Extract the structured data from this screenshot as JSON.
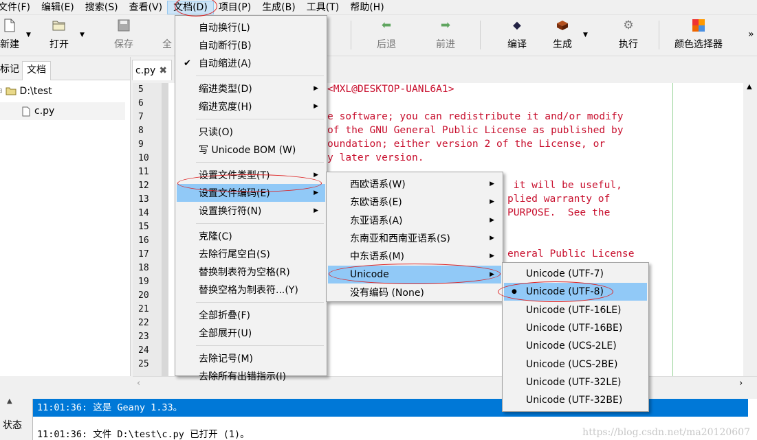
{
  "menubar": [
    "文件(F)",
    "编辑(E)",
    "搜索(S)",
    "查看(V)",
    "文档(D)",
    "项目(P)",
    "生成(B)",
    "工具(T)",
    "帮助(H)"
  ],
  "toolbar": {
    "new": "新建",
    "open": "打开",
    "save": "保存",
    "save_all_partial": "全",
    "back": "后退",
    "forward": "前进",
    "compile": "编译",
    "build": "生成",
    "execute": "执行",
    "color_picker": "颜色选择器",
    "overflow": "»"
  },
  "sidebar": {
    "tabs": [
      "标记",
      "文档"
    ],
    "tree": {
      "folder": "D:\\test",
      "file": "c.py"
    }
  },
  "editor": {
    "tab": "c.py",
    "line_numbers": [
      "5",
      "6",
      "7",
      "8",
      "9",
      "10",
      "11",
      "12",
      "13",
      "14",
      "15",
      "16",
      "17",
      "18",
      "19",
      "20",
      "21",
      "22",
      "23",
      "24",
      "25"
    ],
    "visible_text": [
      "<MXL@DESKTOP-UANL6A1>",
      "",
      "e software; you can redistribute it and/or modify",
      "of the GNU General Public License as published by",
      "oundation; either version 2 of the License, or",
      "y later version.",
      "",
      " it will be useful,",
      "plied warranty of",
      "PURPOSE.  See the",
      "",
      "",
      "eneral Public License"
    ]
  },
  "document_menu": {
    "items": [
      {
        "label": "自动换行(L)"
      },
      {
        "label": "自动断行(B)"
      },
      {
        "label": "自动缩进(A)",
        "checked": true
      },
      {
        "label": "缩进类型(D)",
        "submenu": true
      },
      {
        "label": "缩进宽度(H)",
        "submenu": true
      },
      {
        "label": "只读(O)"
      },
      {
        "label": "写 Unicode BOM (W)"
      },
      {
        "label": "设置文件类型(T)",
        "submenu": true
      },
      {
        "label": "设置文件编码(E)",
        "submenu": true,
        "highlighted": true
      },
      {
        "label": "设置换行符(N)",
        "submenu": true
      },
      {
        "label": "克隆(C)"
      },
      {
        "label": "去除行尾空白(S)"
      },
      {
        "label": "替换制表符为空格(R)"
      },
      {
        "label": "替换空格为制表符...(Y)"
      },
      {
        "label": "全部折叠(F)"
      },
      {
        "label": "全部展开(U)"
      },
      {
        "label": "去除记号(M)"
      },
      {
        "label": "去除所有出错指示(I)"
      }
    ]
  },
  "encoding_menu": {
    "items": [
      {
        "label": "西欧语系(W)",
        "submenu": true
      },
      {
        "label": "东欧语系(E)",
        "submenu": true
      },
      {
        "label": "东亚语系(A)",
        "submenu": true
      },
      {
        "label": "东南亚和西南亚语系(S)",
        "submenu": true
      },
      {
        "label": "中东语系(M)",
        "submenu": true
      },
      {
        "label": "Unicode",
        "submenu": true,
        "highlighted": true
      },
      {
        "label": "没有编码 (None)"
      }
    ]
  },
  "unicode_menu": {
    "items": [
      {
        "label": "Unicode (UTF-7)"
      },
      {
        "label": "Unicode (UTF-8)",
        "selected": true,
        "highlighted": true
      },
      {
        "label": "Unicode (UTF-16LE)"
      },
      {
        "label": "Unicode (UTF-16BE)"
      },
      {
        "label": "Unicode (UCS-2LE)"
      },
      {
        "label": "Unicode (UCS-2BE)"
      },
      {
        "label": "Unicode (UTF-32LE)"
      },
      {
        "label": "Unicode (UTF-32BE)"
      }
    ]
  },
  "status": {
    "label": "状态",
    "messages": [
      "11:01:36: 这是 Geany 1.33。",
      "11:01:36: 文件 D:\\test\\c.py 已打开 (1)。"
    ]
  },
  "watermark": "https://blog.csdn.net/ma20120607",
  "colors": {
    "highlight": "#91c9f7",
    "selection_blue": "#0078d7",
    "code_red": "#c8102e"
  }
}
